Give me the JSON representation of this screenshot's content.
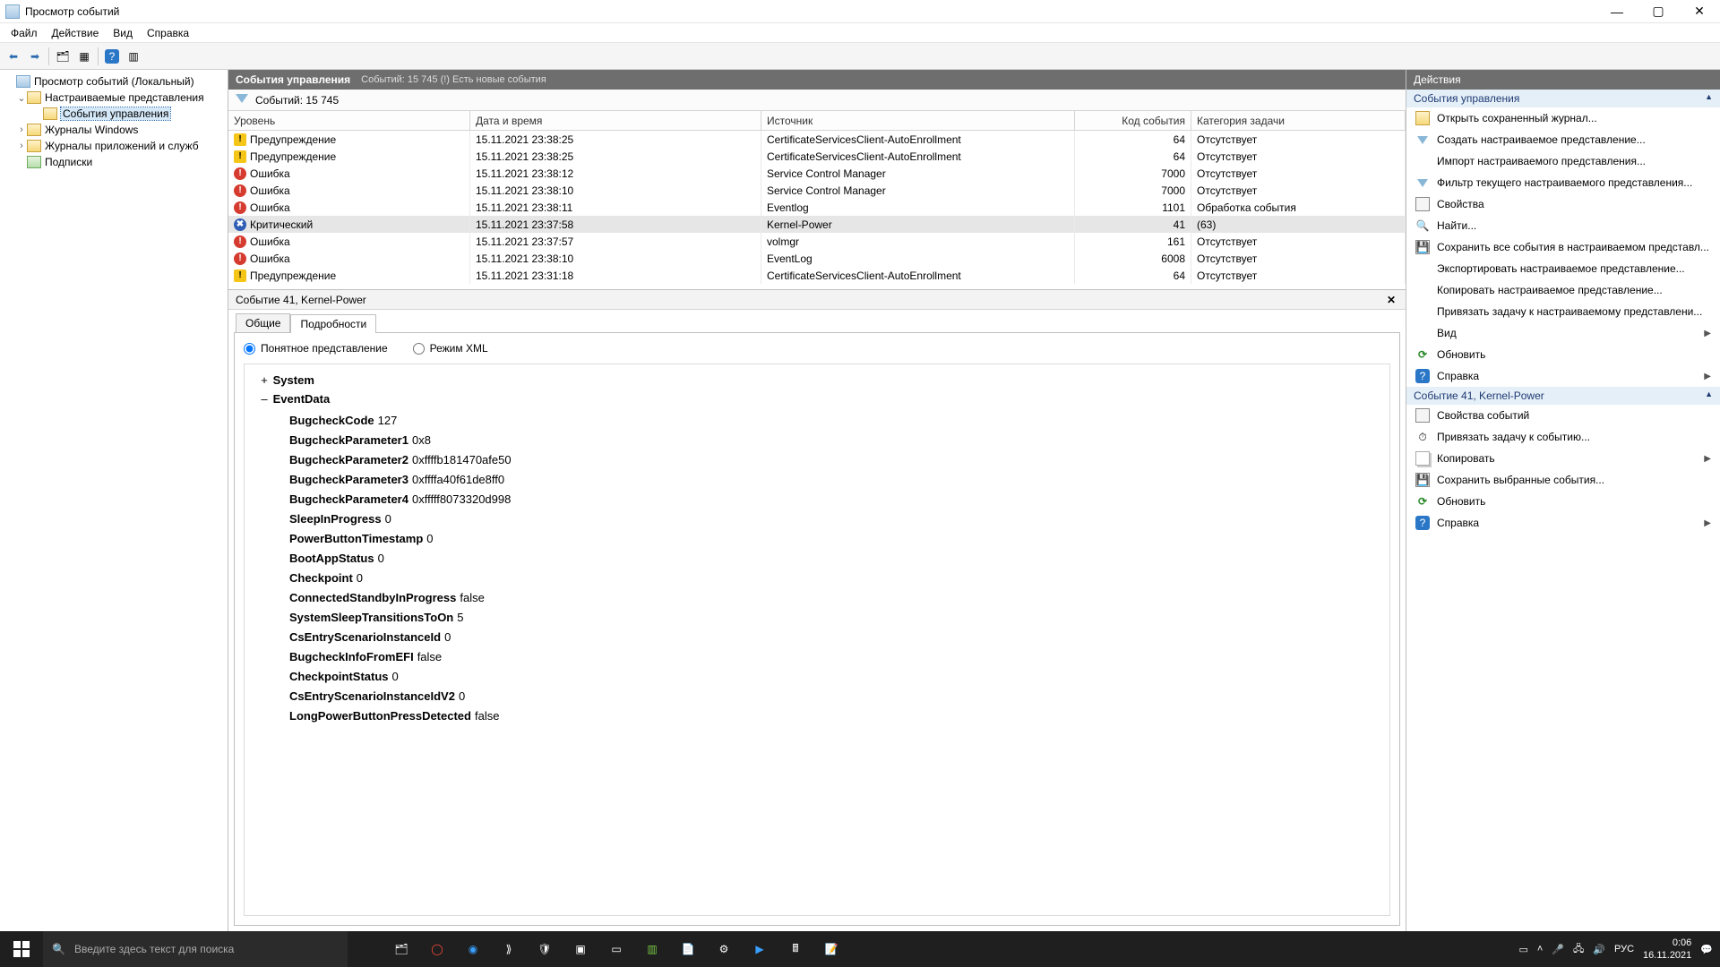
{
  "window": {
    "title": "Просмотр событий",
    "min": "—",
    "max": "▢",
    "close": "✕"
  },
  "menu": [
    "Файл",
    "Действие",
    "Вид",
    "Справка"
  ],
  "tree": {
    "root": "Просмотр событий (Локальный)",
    "custom_views": "Настраиваемые представления",
    "admin_events": "События управления",
    "win_logs": "Журналы Windows",
    "app_logs": "Журналы приложений и служб",
    "subscriptions": "Подписки"
  },
  "strip": {
    "title": "События управления",
    "sub": "Событий: 15 745 (!) Есть новые события"
  },
  "filter": {
    "count_label": "Событий: 15 745"
  },
  "columns": {
    "level": "Уровень",
    "date": "Дата и время",
    "source": "Источник",
    "id": "Код события",
    "task": "Категория задачи"
  },
  "levels": {
    "warn": "Предупреждение",
    "err": "Ошибка",
    "crit": "Критический"
  },
  "rows": [
    {
      "lvl": "warn",
      "date": "15.11.2021 23:38:25",
      "src": "CertificateServicesClient-AutoEnrollment",
      "id": "64",
      "task": "Отсутствует"
    },
    {
      "lvl": "warn",
      "date": "15.11.2021 23:38:25",
      "src": "CertificateServicesClient-AutoEnrollment",
      "id": "64",
      "task": "Отсутствует"
    },
    {
      "lvl": "err",
      "date": "15.11.2021 23:38:12",
      "src": "Service Control Manager",
      "id": "7000",
      "task": "Отсутствует"
    },
    {
      "lvl": "err",
      "date": "15.11.2021 23:38:10",
      "src": "Service Control Manager",
      "id": "7000",
      "task": "Отсутствует"
    },
    {
      "lvl": "err",
      "date": "15.11.2021 23:38:11",
      "src": "Eventlog",
      "id": "1101",
      "task": "Обработка события"
    },
    {
      "lvl": "crit",
      "date": "15.11.2021 23:37:58",
      "src": "Kernel-Power",
      "id": "41",
      "task": "(63)"
    },
    {
      "lvl": "err",
      "date": "15.11.2021 23:37:57",
      "src": "volmgr",
      "id": "161",
      "task": "Отсутствует"
    },
    {
      "lvl": "err",
      "date": "15.11.2021 23:38:10",
      "src": "EventLog",
      "id": "6008",
      "task": "Отсутствует"
    },
    {
      "lvl": "warn",
      "date": "15.11.2021 23:31:18",
      "src": "CertificateServicesClient-AutoEnrollment",
      "id": "64",
      "task": "Отсутствует"
    }
  ],
  "details": {
    "header": "Событие 41, Kernel-Power",
    "tabs": {
      "general": "Общие",
      "details": "Подробности"
    },
    "radio": {
      "friendly": "Понятное представление",
      "xml": "Режим XML"
    },
    "system_label": "System",
    "eventdata_label": "EventData",
    "data": [
      {
        "k": "BugcheckCode",
        "v": "127"
      },
      {
        "k": "BugcheckParameter1",
        "v": "0x8"
      },
      {
        "k": "BugcheckParameter2",
        "v": "0xffffb181470afe50"
      },
      {
        "k": "BugcheckParameter3",
        "v": "0xffffa40f61de8ff0"
      },
      {
        "k": "BugcheckParameter4",
        "v": "0xfffff8073320d998"
      },
      {
        "k": "SleepInProgress",
        "v": "0"
      },
      {
        "k": "PowerButtonTimestamp",
        "v": "0"
      },
      {
        "k": "BootAppStatus",
        "v": "0"
      },
      {
        "k": "Checkpoint",
        "v": "0"
      },
      {
        "k": "ConnectedStandbyInProgress",
        "v": "false"
      },
      {
        "k": "SystemSleepTransitionsToOn",
        "v": "5"
      },
      {
        "k": "CsEntryScenarioInstanceId",
        "v": "0"
      },
      {
        "k": "BugcheckInfoFromEFI",
        "v": "false"
      },
      {
        "k": "CheckpointStatus",
        "v": "0"
      },
      {
        "k": "CsEntryScenarioInstanceIdV2",
        "v": "0"
      },
      {
        "k": "LongPowerButtonPressDetected",
        "v": "false"
      }
    ]
  },
  "actions": {
    "title": "Действия",
    "section1": "События управления",
    "group1": [
      {
        "icon": "open",
        "label": "Открыть сохраненный журнал..."
      },
      {
        "icon": "filter",
        "label": "Создать настраиваемое представление..."
      },
      {
        "icon": "none",
        "label": "Импорт настраиваемого представления..."
      },
      {
        "icon": "filter",
        "label": "Фильтр текущего настраиваемого представления..."
      },
      {
        "icon": "prop",
        "label": "Свойства"
      },
      {
        "icon": "find",
        "label": "Найти..."
      },
      {
        "icon": "save",
        "label": "Сохранить все события в настраиваемом представл..."
      },
      {
        "icon": "none",
        "label": "Экспортировать настраиваемое представление..."
      },
      {
        "icon": "none",
        "label": "Копировать настраиваемое представление..."
      },
      {
        "icon": "none",
        "label": "Привязать задачу к настраиваемому представлени..."
      },
      {
        "icon": "none",
        "label": "Вид",
        "submenu": true
      },
      {
        "icon": "refresh",
        "label": "Обновить"
      },
      {
        "icon": "help",
        "label": "Справка",
        "submenu": true
      }
    ],
    "section2": "Событие 41, Kernel-Power",
    "group2": [
      {
        "icon": "prop",
        "label": "Свойства событий"
      },
      {
        "icon": "task",
        "label": "Привязать задачу к событию..."
      },
      {
        "icon": "copy",
        "label": "Копировать",
        "submenu": true
      },
      {
        "icon": "save",
        "label": "Сохранить выбранные события..."
      },
      {
        "icon": "refresh",
        "label": "Обновить"
      },
      {
        "icon": "help",
        "label": "Справка",
        "submenu": true
      }
    ]
  },
  "taskbar": {
    "search_placeholder": "Введите здесь текст для поиска",
    "lang": "РУС",
    "time": "0:06",
    "date": "16.11.2021"
  }
}
